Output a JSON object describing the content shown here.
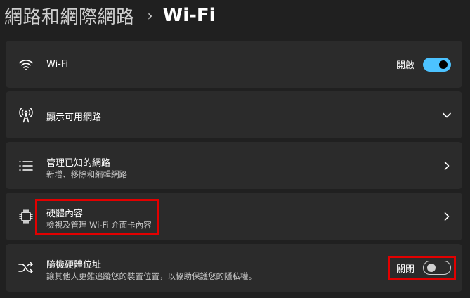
{
  "breadcrumb": {
    "parent": "網路和網際網路",
    "separator": "›",
    "current": "Wi-Fi"
  },
  "wifi": {
    "title": "Wi-Fi",
    "toggle_label": "開啟",
    "toggle_state": "on",
    "icon": "wifi-icon"
  },
  "available_networks": {
    "title": "顯示可用網路",
    "icon": "antenna-icon",
    "expand_icon": "chevron-down-icon"
  },
  "manage_known": {
    "title": "管理已知的網路",
    "subtitle": "新增、移除和編輯網路",
    "icon": "list-icon"
  },
  "hardware_properties": {
    "title": "硬體內容",
    "subtitle": "檢視及管理 Wi-Fi 介面卡內容",
    "icon": "chip-icon"
  },
  "random_address": {
    "title": "隨機硬體位址",
    "subtitle": "讓其他人更難追蹤您的裝置位置，以協助保護您的隱私權。",
    "toggle_label": "關閉",
    "toggle_state": "off",
    "icon": "shuffle-icon"
  },
  "colors": {
    "background": "#202020",
    "card": "#2b2b2b",
    "accent": "#4cc2ff",
    "highlight": "#e20000"
  }
}
